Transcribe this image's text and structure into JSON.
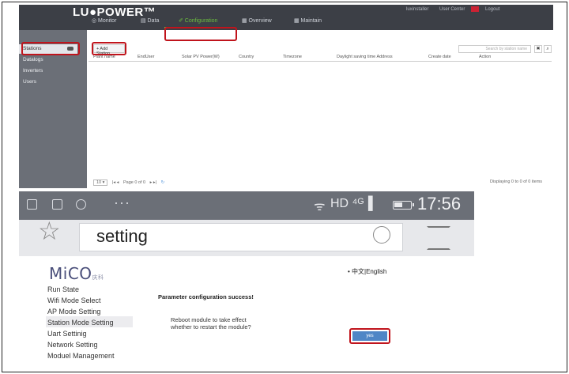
{
  "app": {
    "brand": "LU●POWER™",
    "header_links": [
      "luxinstaller",
      "User Center",
      "Logout"
    ],
    "nav_tabs": [
      {
        "label": "◎ Monitor",
        "active": false
      },
      {
        "label": "▤ Data",
        "active": false
      },
      {
        "label": "✐ Configuration",
        "active": true
      },
      {
        "label": "▦ Overview",
        "active": false
      },
      {
        "label": "▦ Maintain",
        "active": false
      }
    ],
    "sidebar": [
      "Stations",
      "Datalogs",
      "Inverters",
      "Users"
    ],
    "add_button": "+ Add Station",
    "search_placeholder": "Search by station name",
    "table_headers": [
      "Plant name",
      "EndUser",
      "Solar PV Power(W)",
      "Country",
      "Timezone",
      "Daylight saving time Address",
      "Create date",
      "Action"
    ],
    "pager_text": "Page 0 of 0",
    "pager_size": "10",
    "displaying": "Displaying 0 to 0 of 0 items",
    "accent_color": "#6cbf3f"
  },
  "phone": {
    "time": "17:56",
    "network": "HD",
    "battery_fraction": 0.55,
    "url_text": "setting",
    "status_dots": "···"
  },
  "mico": {
    "logo": "MiCO",
    "logo_sub": "庆科",
    "language": "• 中文|English",
    "menu": [
      "Run State",
      "Wifi Mode Select",
      "AP Mode Setting",
      "Station Mode Setting",
      "Uart Settinig",
      "Network Setting",
      "Moduel Management"
    ],
    "selected_menu": "Station Mode Setting",
    "success_msg": "Parameter configuration success!",
    "reboot_line1": "Reboot module to take effect",
    "reboot_line2": "whether to restart the module?",
    "yes_button": "yes",
    "highlight_color": "#c0141c"
  }
}
